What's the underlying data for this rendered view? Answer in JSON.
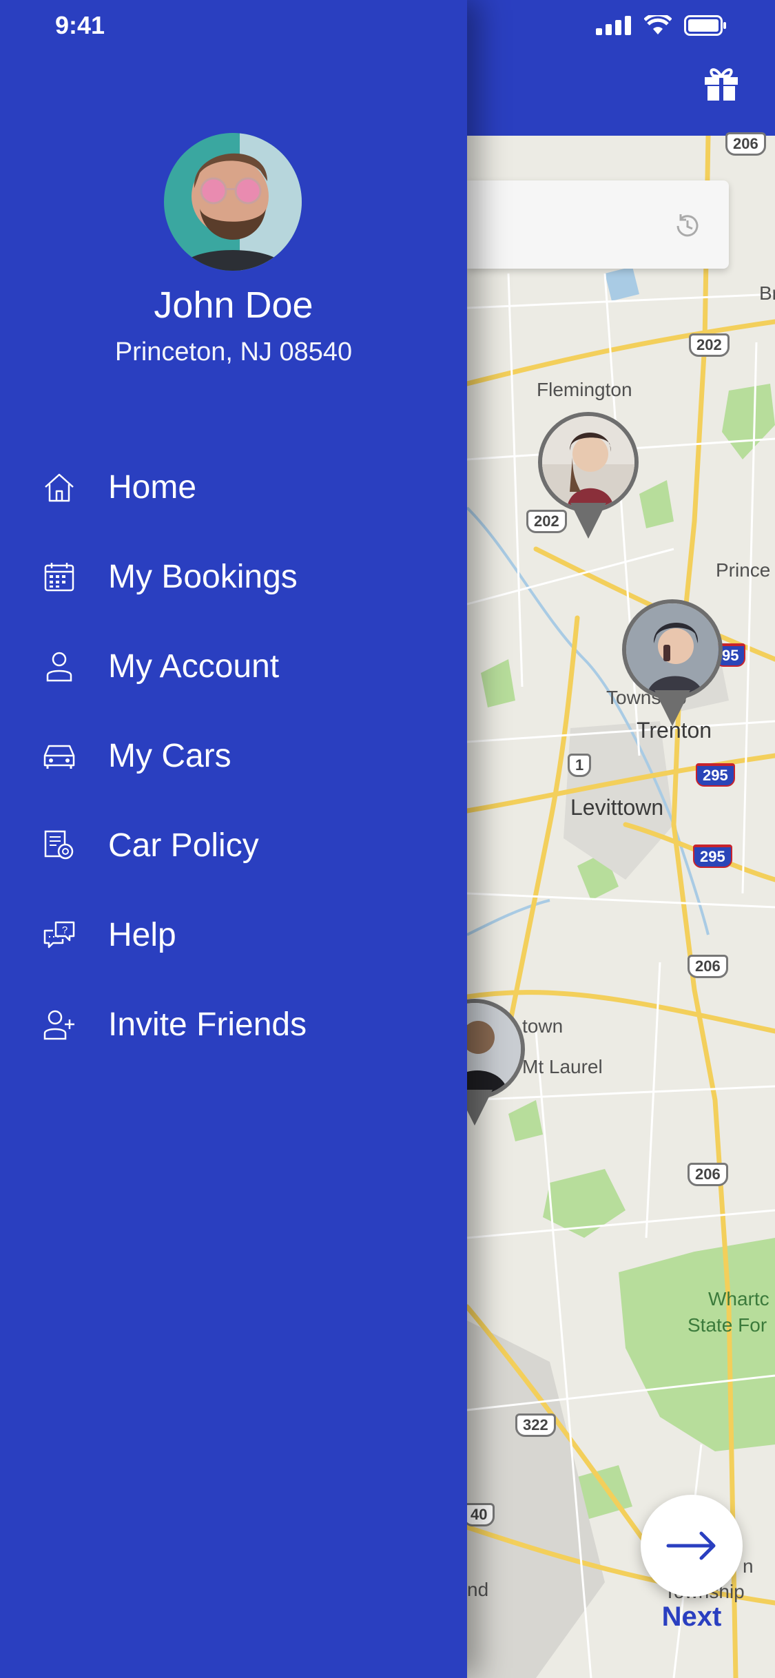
{
  "status_bar": {
    "time": "9:41"
  },
  "user": {
    "name": "John Doe",
    "location": "Princeton, NJ 08540"
  },
  "menu": [
    {
      "label": "Home",
      "icon": "home-icon"
    },
    {
      "label": "My Bookings",
      "icon": "calendar-icon"
    },
    {
      "label": "My Account",
      "icon": "user-icon"
    },
    {
      "label": "My Cars",
      "icon": "car-icon"
    },
    {
      "label": "Car Policy",
      "icon": "policy-icon"
    },
    {
      "label": "Help",
      "icon": "help-chat-icon"
    },
    {
      "label": "Invite Friends",
      "icon": "add-user-icon"
    }
  ],
  "map": {
    "labels": [
      "Flemington",
      "Prince",
      "Township",
      "Trenton",
      "Levittown",
      "town",
      "Mt Laurel",
      "Whartc",
      "State For",
      "nd",
      "n",
      "Township",
      "Br"
    ],
    "routes": [
      "206",
      "202",
      "202",
      "95",
      "1",
      "295",
      "295",
      "206",
      "206",
      "322",
      "40"
    ]
  },
  "next_button": {
    "label": "Next"
  },
  "colors": {
    "brand": "#2a3fc0",
    "drawer_text": "#ffffff"
  }
}
